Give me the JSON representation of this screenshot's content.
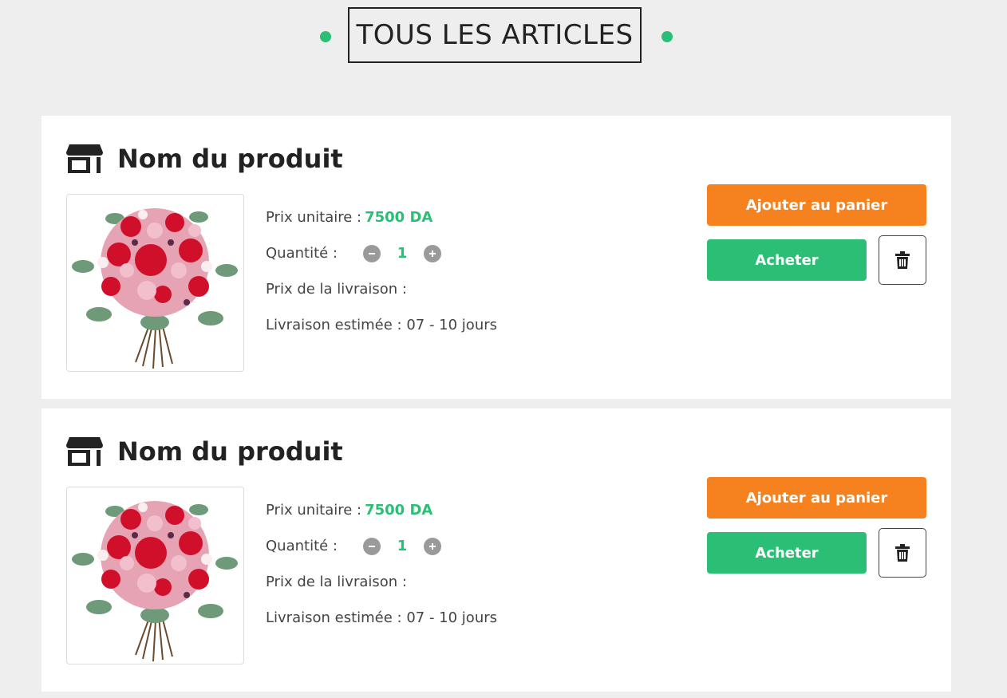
{
  "header": {
    "title": "TOUS LES ARTICLES"
  },
  "colors": {
    "accent": "#2bbf75",
    "orange": "#f5821f",
    "background": "#eeeeee"
  },
  "products": [
    {
      "name": "Nom du produit",
      "unit_price_label": "Prix unitaire :",
      "unit_price": "7500 DA",
      "quantity_label": "Quantité :",
      "quantity": "1",
      "delivery_price_label": "Prix de la livraison :",
      "estimated_delivery": "Livraison estimée : 07 - 10 jours",
      "add_to_cart": "Ajouter au panier",
      "buy": "Acheter",
      "delete_icon": "trash-icon"
    },
    {
      "name": "Nom du produit",
      "unit_price_label": "Prix unitaire :",
      "unit_price": "7500 DA",
      "quantity_label": "Quantité :",
      "quantity": "1",
      "delivery_price_label": "Prix de la livraison :",
      "estimated_delivery": "Livraison estimée : 07 - 10 jours",
      "add_to_cart": "Ajouter au panier",
      "buy": "Acheter",
      "delete_icon": "trash-icon"
    }
  ]
}
